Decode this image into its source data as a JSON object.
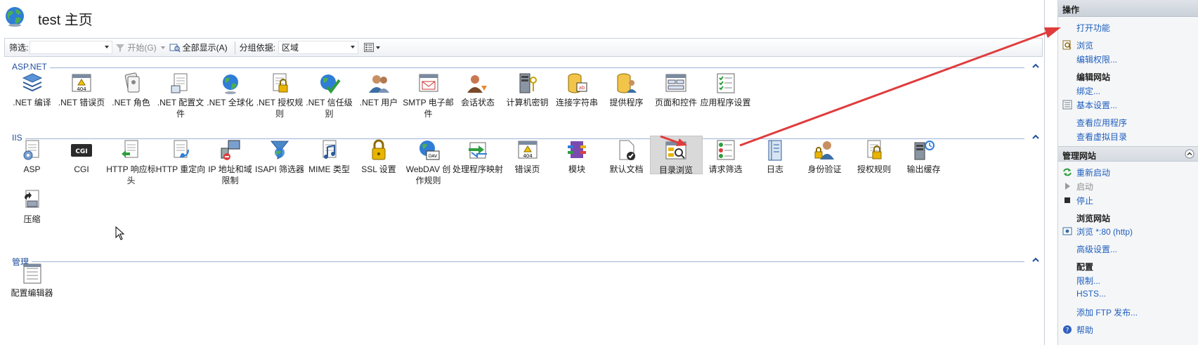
{
  "header": {
    "title": "test 主页"
  },
  "toolbar": {
    "filter_label": "筛选:",
    "filter_value": "",
    "start_label": "开始(G)",
    "show_all_label": "全部显示(A)",
    "group_label": "分组依据:",
    "group_value": "区域"
  },
  "sections": {
    "aspnet": "ASP.NET",
    "iis": "IIS",
    "manage": "管理"
  },
  "features": {
    "aspnet": [
      ".NET 编译",
      ".NET 错误页",
      ".NET 角色",
      ".NET 配置文件",
      ".NET 全球化",
      ".NET 授权规则",
      ".NET 信任级别",
      ".NET 用户",
      "SMTP 电子邮件",
      "会话状态",
      "计算机密钥",
      "连接字符串",
      "提供程序",
      "页面和控件",
      "应用程序设置"
    ],
    "iis": [
      "ASP",
      "CGI",
      "HTTP 响应标头",
      "HTTP 重定向",
      "IP 地址和域限制",
      "ISAPI 筛选器",
      "MIME 类型",
      "SSL 设置",
      "WebDAV 创作规则",
      "处理程序映射",
      "错误页",
      "模块",
      "默认文档",
      "目录浏览",
      "请求筛选",
      "日志",
      "身份验证",
      "授权规则",
      "输出缓存",
      "压缩"
    ],
    "manage": [
      "配置编辑器"
    ],
    "cgi_icon_text": "CGI",
    "err_icon_text": "404"
  },
  "actions": {
    "title": "操作",
    "open_feature": "打开功能",
    "browse": "浏览",
    "edit_perms": "编辑权限...",
    "edit_site": "编辑网站",
    "bindings": "绑定...",
    "basic_settings": "基本设置...",
    "view_apps": "查看应用程序",
    "view_vdirs": "查看虚拟目录",
    "manage_site": "管理网站",
    "restart": "重新启动",
    "start": "启动",
    "stop": "停止",
    "browse_site": "浏览网站",
    "browse_80": "浏览 *:80 (http)",
    "advanced": "高级设置...",
    "config": "配置",
    "limits": "限制...",
    "hsts": "HSTS...",
    "add_ftp": "添加 FTP 发布...",
    "help": "帮助"
  },
  "colors": {
    "link": "#1f5fbf",
    "section": "#1f4e9c",
    "arrow": "#e03c3c"
  }
}
